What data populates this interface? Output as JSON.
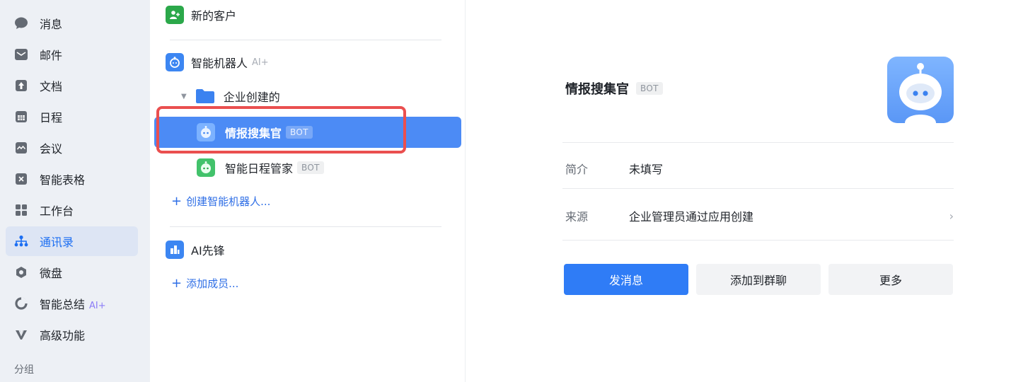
{
  "sidebar": {
    "items": [
      {
        "label": "消息",
        "icon": "chat-bubble-icon"
      },
      {
        "label": "邮件",
        "icon": "mail-icon"
      },
      {
        "label": "文档",
        "icon": "document-icon"
      },
      {
        "label": "日程",
        "icon": "calendar-icon"
      },
      {
        "label": "会议",
        "icon": "meeting-icon"
      },
      {
        "label": "智能表格",
        "icon": "smart-table-icon"
      },
      {
        "label": "工作台",
        "icon": "workbench-icon"
      },
      {
        "label": "通讯录",
        "icon": "contacts-icon"
      },
      {
        "label": "微盘",
        "icon": "drive-icon"
      },
      {
        "label": "智能总结",
        "icon": "summary-icon",
        "ai_tag": "AI+"
      },
      {
        "label": "高级功能",
        "icon": "advanced-icon"
      }
    ],
    "group_label": "分组",
    "active_color": "#1d6ff2"
  },
  "middle": {
    "new_customers": "新的客户",
    "smart_bots": "智能机器人",
    "smart_bots_tag": "AI+",
    "folder": "企业创建的",
    "bots": [
      {
        "name": "情报搜集官",
        "badge": "BOT"
      },
      {
        "name": "智能日程管家",
        "badge": "BOT"
      }
    ],
    "create_bot": "创建智能机器人...",
    "ai_pioneer": "AI先锋",
    "add_member": "添加成员...",
    "selected_color": "#4c8bf5",
    "highlight_color": "#ea4f4f"
  },
  "detail": {
    "title": "情报搜集官",
    "badge": "BOT",
    "intro_key": "简介",
    "intro_value": "未填写",
    "source_key": "来源",
    "source_value": "企业管理员通过应用创建",
    "buttons": {
      "send": "发消息",
      "add_to_group": "添加到群聊",
      "more": "更多"
    },
    "primary_color": "#2f7cf6"
  }
}
